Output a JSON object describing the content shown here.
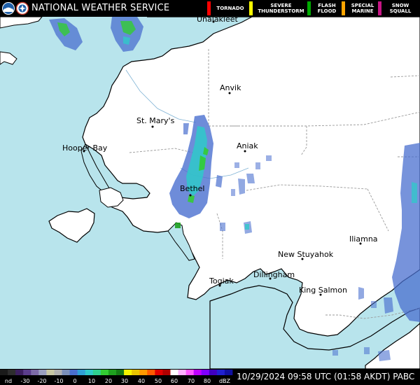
{
  "header": {
    "agency": "NATIONAL WEATHER SERVICE",
    "legend": [
      {
        "label": "TORNADO",
        "color": "#ff0000"
      },
      {
        "label": "SEVERE\nTHUNDERSTORM",
        "color": "#ffff00"
      },
      {
        "label": "FLASH\nFLOOD",
        "color": "#00aa00"
      },
      {
        "label": "SPECIAL\nMARINE",
        "color": "#ffa500"
      },
      {
        "label": "SNOW\nSQUALL",
        "color": "#c71585"
      }
    ]
  },
  "cities": [
    {
      "name": "Unalakleet"
    },
    {
      "name": "Anvik"
    },
    {
      "name": "St. Mary's"
    },
    {
      "name": "Hooper Bay"
    },
    {
      "name": "Aniak"
    },
    {
      "name": "Bethel"
    },
    {
      "name": "New Stuyahok"
    },
    {
      "name": "Iliamna"
    },
    {
      "name": "Dillingham"
    },
    {
      "name": "Togiak"
    },
    {
      "name": "King Salmon"
    }
  ],
  "colorbar": {
    "ticks": [
      "nd",
      "-30",
      "-20",
      "-10",
      "0",
      "10",
      "20",
      "30",
      "40",
      "50",
      "60",
      "70",
      "80",
      "dBZ"
    ],
    "colors": [
      "#1a1a1a",
      "#2d2d2d",
      "#3c1f5f",
      "#5b3d8c",
      "#7d6ba8",
      "#9a9fbf",
      "#c7c7a4",
      "#b0b0b0",
      "#7a8fb8",
      "#4a6fcf",
      "#2f9fd6",
      "#2fc9c9",
      "#2fd08f",
      "#33cc33",
      "#1fa01f",
      "#157a15",
      "#f5f500",
      "#e8c400",
      "#ff9900",
      "#ff5a00",
      "#e00000",
      "#b00000",
      "#ffffff",
      "#ffb0ff",
      "#ff55ff",
      "#c000ff",
      "#8000ff",
      "#4000c0",
      "#2020d0",
      "#1010a0"
    ]
  },
  "timestamp": "10/29/2024 09:58 UTC (01:58 AKDT)",
  "station": "PABC"
}
